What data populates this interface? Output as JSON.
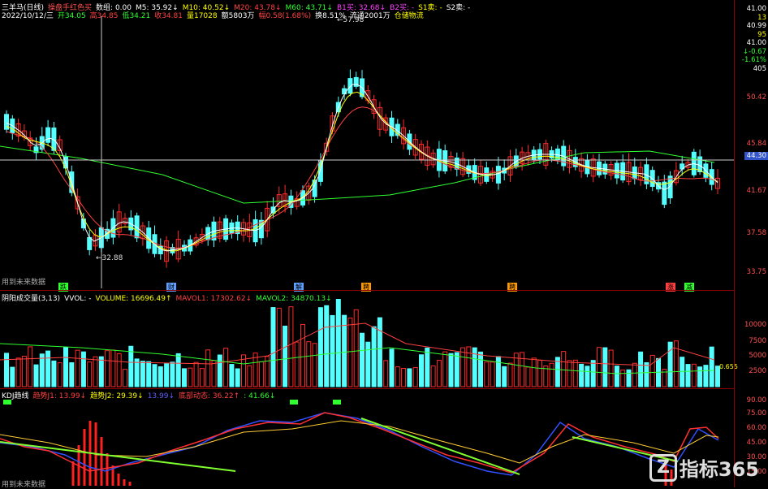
{
  "header": {
    "row1": [
      {
        "text": "三羊马(日线)",
        "color": "#ffffff"
      },
      {
        "text": "操盘手红色买",
        "color": "#ff5050"
      },
      {
        "text": "数组: 0.00",
        "color": "#ffffff"
      },
      {
        "text": "M5: 35.92↓",
        "color": "#ffffff"
      },
      {
        "text": "M10: 40.52↓",
        "color": "#ffff00"
      },
      {
        "text": "M20: 43.78↓",
        "color": "#ff4040"
      },
      {
        "text": "M60: 43.71↓",
        "color": "#30ff30"
      },
      {
        "text": "B1买: 32.68↓",
        "color": "#ff40ff"
      },
      {
        "text": "B2买: -",
        "color": "#ff40ff"
      },
      {
        "text": "S1卖: -",
        "color": "#ffff00"
      },
      {
        "text": "S2卖: -",
        "color": "#ffffff"
      }
    ],
    "row2": [
      {
        "text": "2022/10/12/三",
        "color": "#ffffff"
      },
      {
        "text": "开34.05",
        "color": "#30ff30"
      },
      {
        "text": "高34.85",
        "color": "#ff4040"
      },
      {
        "text": "低34.21",
        "color": "#30ff30"
      },
      {
        "text": "收34.81",
        "color": "#ff4040"
      },
      {
        "text": "量17028",
        "color": "#ffff00"
      },
      {
        "text": "额5803万",
        "color": "#ffffff"
      },
      {
        "text": "幅0.58(1.68%)",
        "color": "#ff4040"
      },
      {
        "text": "换8.51%",
        "color": "#ffffff"
      },
      {
        "text": "流通2001万",
        "color": "#ffffff"
      },
      {
        "text": "仓储物流",
        "color": "#ffff00"
      }
    ]
  },
  "price_axis": {
    "labels": [
      "50.42",
      "45.84",
      "41.67",
      "37.58",
      "33.75"
    ],
    "current": "44.30",
    "quote_box": [
      "41.00",
      "13",
      "40.99",
      "95",
      "41.00",
      "↓-0.67",
      "-1.61%",
      "405"
    ]
  },
  "annotations": {
    "high_label": "57.98",
    "low_label": "32.88",
    "future_note": "用到未来数据",
    "future_note2": "用到未来数据",
    "markers": [
      {
        "text": "跌",
        "color": "#30ff30"
      },
      {
        "text": "财",
        "color": "#5fa0ff"
      },
      {
        "text": "解",
        "color": "#5fa0ff"
      },
      {
        "text": "聘",
        "color": "#ff9900"
      },
      {
        "text": "聘",
        "color": "#ff9900"
      },
      {
        "text": "涨",
        "color": "#ff4040"
      },
      {
        "text": "减",
        "color": "#30ff30"
      }
    ]
  },
  "volume_panel": {
    "header": [
      {
        "text": "阴阳成交量(3,13)",
        "color": "#ffffff"
      },
      {
        "text": "VVOL: -",
        "color": "#ffffff"
      },
      {
        "text": "VOLUME: 16696.49↑",
        "color": "#ffff00"
      },
      {
        "text": "MAVOL1: 17302.62↓",
        "color": "#ff4040"
      },
      {
        "text": "MAVOL2: 34870.13↓",
        "color": "#30ff30"
      }
    ],
    "axis": [
      "10000",
      "7500",
      "5000",
      "2500"
    ],
    "last_label": "0.655"
  },
  "kdj_panel": {
    "header": [
      {
        "text": "KDJ趋线",
        "color": "#ffffff"
      },
      {
        "text": "趋势J1: 13.99↓",
        "color": "#ff4040"
      },
      {
        "text": "趋势J2: 29.39↓",
        "color": "#ffff00"
      },
      {
        "text": "13.99↓",
        "color": "#5f5fff"
      },
      {
        "text": "底部动态: 36.22↑",
        "color": "#ff4040"
      },
      {
        "text": ": 41.66↓",
        "color": "#30ff30"
      }
    ],
    "axis": [
      "90.00",
      "75.00",
      "60.00",
      "45.00",
      "30.00",
      "15.00"
    ]
  },
  "watermark": {
    "logo_letter": "Z",
    "text": "指标365"
  },
  "colors": {
    "up": "#ff2a2a",
    "down": "#54ffff",
    "ma5": "#ffffff",
    "ma10": "#ffff00",
    "ma20": "#ff4040",
    "ma60": "#30ff30",
    "grid": "#8b0000"
  }
}
